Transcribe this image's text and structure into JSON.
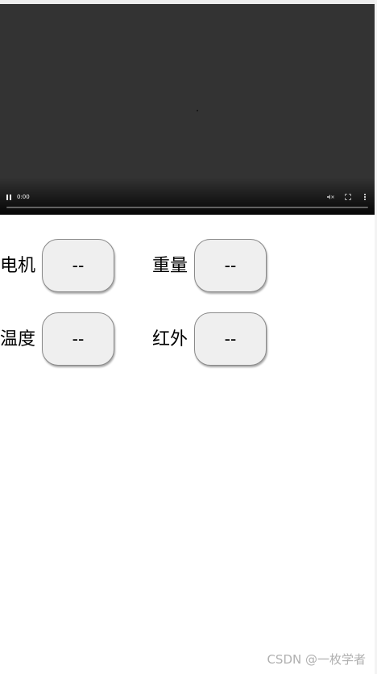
{
  "video": {
    "time": "0:00",
    "controls": {
      "play_pause_icon": "pause-icon",
      "mute_icon": "mute-icon",
      "fullscreen_icon": "fullscreen-icon",
      "more_icon": "more-vertical-icon"
    }
  },
  "sensors": [
    {
      "label": "电机",
      "value": "--"
    },
    {
      "label": "重量",
      "value": "--"
    },
    {
      "label": "温度",
      "value": "--"
    },
    {
      "label": "红外",
      "value": "--"
    }
  ],
  "watermark": "CSDN @一枚学者",
  "colors": {
    "video_background": "#333333",
    "button_background": "#efefef",
    "button_border": "#8a8a8a",
    "watermark_text": "#b0b0b0"
  }
}
